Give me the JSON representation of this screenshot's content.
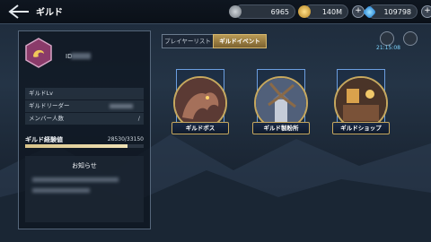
{
  "header": {
    "title": "ギルド",
    "resources": [
      {
        "name": "silver-coin",
        "value": "6965"
      },
      {
        "name": "gold-coin",
        "value": "140M"
      },
      {
        "name": "blue-gem",
        "value": "109798"
      }
    ]
  },
  "guild": {
    "id_label": "ID",
    "rows": [
      {
        "label": "ギルドLv",
        "value": ""
      },
      {
        "label": "ギルドリーダー",
        "value": ""
      },
      {
        "label": "メンバー人数",
        "value": "/"
      }
    ],
    "xp_label": "ギルド経験値",
    "xp_value": "28530/33150",
    "xp_fraction": 0.861,
    "notice_title": "お知らせ"
  },
  "tabs": [
    {
      "label": "プレイヤーリスト",
      "active": false
    },
    {
      "label": "ギルドイベント",
      "active": true
    }
  ],
  "timer": "21:15:08",
  "cards": [
    {
      "label": "ギルドボス"
    },
    {
      "label": "ギルド製粉所"
    },
    {
      "label": "ギルドショップ"
    }
  ],
  "colors": {
    "accent_gold": "#c7a85e",
    "timer_blue": "#7fd6ff",
    "banner_blue": "#6b9ee0"
  }
}
